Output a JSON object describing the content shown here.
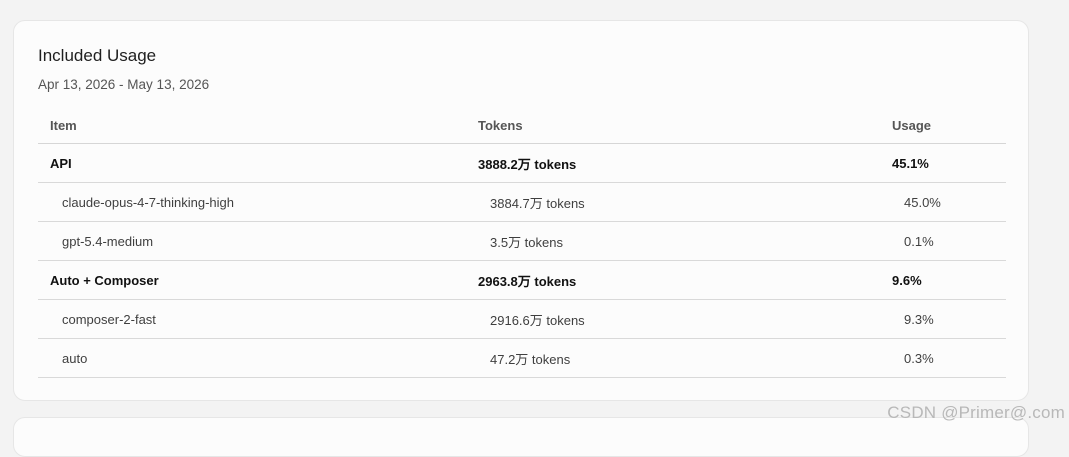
{
  "card": {
    "title": "Included Usage",
    "date_range": "Apr 13, 2026 - May 13, 2026"
  },
  "table": {
    "headers": [
      "Item",
      "Tokens",
      "Usage"
    ],
    "rows": [
      {
        "item": "API",
        "tokens": "3888.2万 tokens",
        "usage": "45.1%"
      },
      {
        "item": "claude-opus-4-7-thinking-high",
        "tokens": "3884.7万 tokens",
        "usage": "45.0%"
      },
      {
        "item": "gpt-5.4-medium",
        "tokens": "3.5万 tokens",
        "usage": "0.1%"
      },
      {
        "item": "Auto + Composer",
        "tokens": "2963.8万 tokens",
        "usage": "9.6%"
      },
      {
        "item": "composer-2-fast",
        "tokens": "2916.6万 tokens",
        "usage": "9.3%"
      },
      {
        "item": "auto",
        "tokens": "47.2万 tokens",
        "usage": "0.3%"
      }
    ]
  },
  "watermark": "CSDN @Primer@.com"
}
